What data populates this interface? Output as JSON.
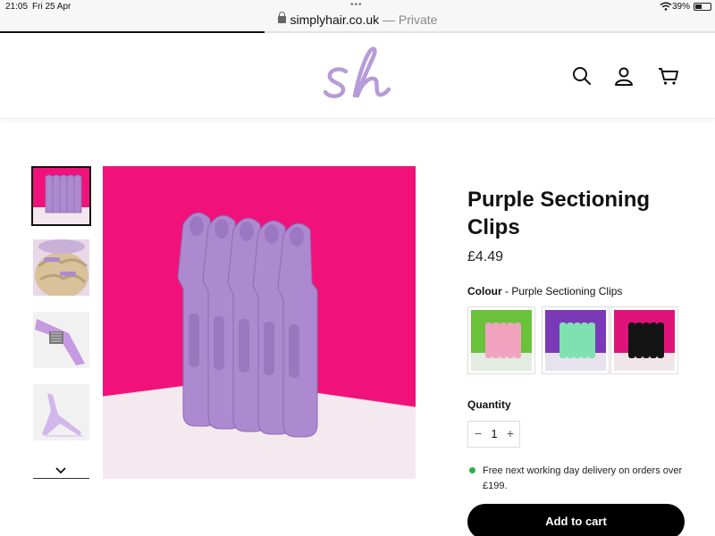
{
  "status_bar": {
    "time": "21:05",
    "date": "Fri 25 Apr",
    "battery": "39%"
  },
  "browser": {
    "domain": "simplyhair.co.uk",
    "mode": "— Private",
    "load_progress": 0.37
  },
  "header": {
    "logo_text": "sh",
    "icons": [
      "search-icon",
      "account-icon",
      "cart-icon"
    ]
  },
  "gallery": {
    "thumbnails": [
      "thumbnail-clips-pink",
      "thumbnail-clips-in-hair",
      "thumbnail-clip-closeup",
      "thumbnail-clip-side"
    ],
    "active_index": 0
  },
  "product": {
    "title": "Purple Sectioning Clips",
    "price": "£4.49",
    "colour_label": "Colour",
    "colour_separator": " - ",
    "colour_value": "Purple Sectioning Clips",
    "swatches": [
      "pink-clips",
      "mint-clips",
      "black-clips"
    ],
    "quantity_label": "Quantity",
    "quantity": "1",
    "minus": "−",
    "plus": "+",
    "delivery_text": "Free next working day delivery on orders over £199.",
    "add_to_cart": "Add to cart"
  },
  "colors": {
    "brand_purple": "#b79bd8",
    "accent_magenta": "#f0127a",
    "clip_purple": "#ad8ad0",
    "delivery_green": "#2bb04a"
  }
}
